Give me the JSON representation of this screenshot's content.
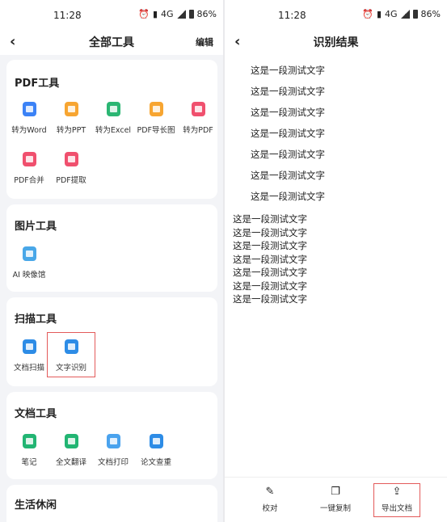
{
  "left": {
    "status": {
      "time": "11:28",
      "signal": "4G",
      "battery": "86%"
    },
    "nav": {
      "back": "‹",
      "title": "全部工具",
      "edit": "编辑"
    },
    "sections": [
      {
        "title": "PDF工具",
        "tools": [
          {
            "label": "转为Word",
            "color": "#3b82f6"
          },
          {
            "label": "转为PPT",
            "color": "#f7a531"
          },
          {
            "label": "转为Excel",
            "color": "#2bb673"
          },
          {
            "label": "PDF导长图",
            "color": "#f7a531"
          },
          {
            "label": "转为PDF",
            "color": "#f0506e"
          },
          {
            "label": "PDF合并",
            "color": "#f0506e"
          },
          {
            "label": "PDF提取",
            "color": "#f0506e"
          }
        ]
      },
      {
        "title": "图片工具",
        "tools": [
          {
            "label": "AI 映像馆",
            "color": "#49a7e8"
          }
        ]
      },
      {
        "title": "扫描工具",
        "tools": [
          {
            "label": "文档扫描",
            "color": "#2d8ce6"
          },
          {
            "label": "文字识别",
            "color": "#2d8ce6"
          }
        ]
      },
      {
        "title": "文档工具",
        "tools": [
          {
            "label": "笔记",
            "color": "#22b573"
          },
          {
            "label": "全文翻译",
            "color": "#22b573"
          },
          {
            "label": "文档打印",
            "color": "#4aa3ee"
          },
          {
            "label": "论文查重",
            "color": "#2d8ce6"
          }
        ]
      },
      {
        "title": "生活休闲",
        "tools": []
      }
    ]
  },
  "right": {
    "status": {
      "time": "11:28",
      "signal": "4G",
      "battery": "86%"
    },
    "nav": {
      "back": "‹",
      "title": "识别结果"
    },
    "ocr_lines": [
      "这是一段测试文字",
      "这是一段测试文字",
      "这是一段测试文字",
      "这是一段测试文字",
      "这是一段测试文字",
      "这是一段测试文字",
      "这是一段测试文字"
    ],
    "plain_lines": [
      "这是一段测试文字",
      "这是一段测试文字",
      "这是一段测试文字",
      "这是一段测试文字",
      "这是一段测试文字",
      "这是一段测试文字",
      "这是一段测试文字"
    ],
    "bottom": [
      {
        "label": "校对",
        "icon": "proofread-icon"
      },
      {
        "label": "一键复制",
        "icon": "copy-icon"
      },
      {
        "label": "导出文档",
        "icon": "export-icon"
      }
    ]
  },
  "colors": {
    "highlight": "#e35a5a",
    "background": "#f3f4f7"
  }
}
